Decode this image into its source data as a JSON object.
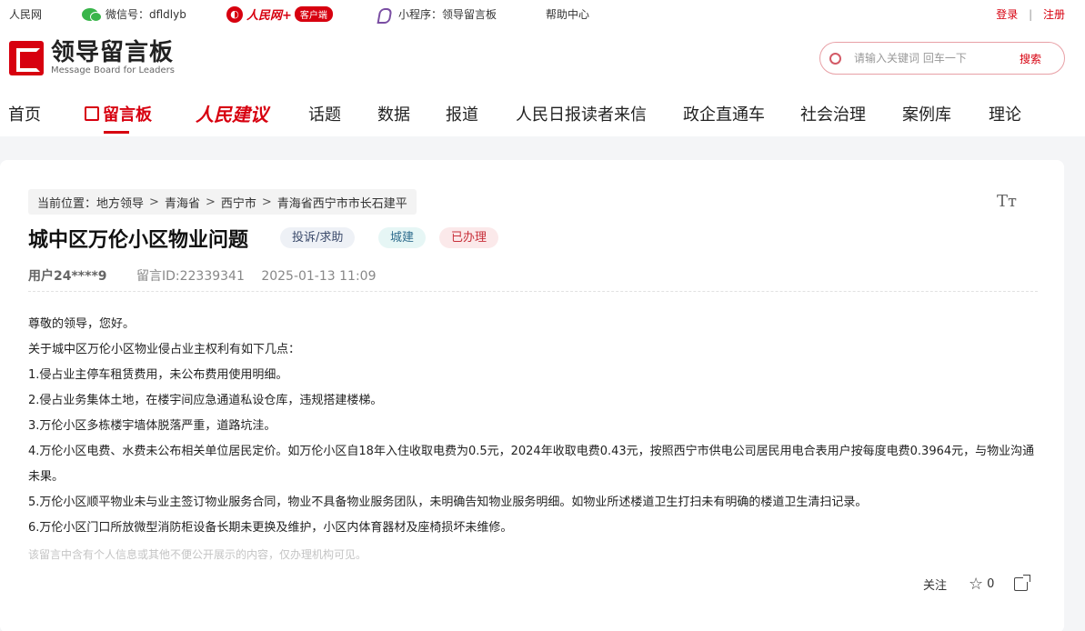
{
  "topbar": {
    "renminwang": "人民网",
    "wechat_label": "微信号：dfldlyb",
    "rmw_plus": "人民网+",
    "rmw_badge": "客户端",
    "miniprogram": "小程序：领导留言板",
    "help": "帮助中心",
    "login": "登录",
    "separator": "|",
    "register": "注册"
  },
  "logo": {
    "cn": "领导留言板",
    "en": "Message Board for Leaders"
  },
  "search": {
    "placeholder": "请输入关键词 回车一下",
    "button": "搜索"
  },
  "nav": {
    "items": [
      "首页",
      "留言板",
      "人民建议",
      "话题",
      "数据",
      "报道",
      "人民日报读者来信",
      "政企直通车",
      "社会治理",
      "案例库",
      "理论"
    ],
    "active": "留言板"
  },
  "breadcrumb": {
    "prefix": "当前位置：",
    "items": [
      "地方领导",
      "青海省",
      "西宁市",
      "青海省西宁市市长石建平"
    ],
    "separator": ">"
  },
  "font_toggle": "Tт",
  "post": {
    "title": "城中区万伦小区物业问题",
    "tags": [
      "投诉/求助",
      "城建",
      "已办理"
    ],
    "user": "用户24****9",
    "message_id": "留言ID:22339341",
    "datetime": "2025-01-13 11:09",
    "body": [
      "尊敬的领导，您好。",
      "关于城中区万伦小区物业侵占业主权利有如下几点：",
      "1.侵占业主停车租赁费用，未公布费用使用明细。",
      "2.侵占业务集体土地，在楼宇间应急通道私设仓库，违规搭建楼梯。",
      "3.万伦小区多栋楼宇墙体脱落严重，道路坑洼。",
      "4.万伦小区电费、水费未公布相关单位居民定价。如万伦小区自18年入住收取电费为0.5元，2024年收取电费0.43元，按照西宁市供电公司居民用电合表用户按每度电费0.3964元，与物业沟通未果。",
      "5.万伦小区顺平物业未与业主签订物业服务合同，物业不具备物业服务团队，未明确告知物业服务明细。如物业所述楼道卫生打扫未有明确的楼道卫生清扫记录。",
      "6.万伦小区门口所放微型消防柜设备长期未更换及维护，小区内体育器材及座椅损坏未维修。"
    ],
    "notice": "该留言中含有个人信息或其他不便公开展示的内容，仅办理机构可见。"
  },
  "actions": {
    "follow": "关注",
    "like_count": "0"
  },
  "colors": {
    "brand_red": "#d7000f",
    "page_bg": "#f4f5f7"
  }
}
